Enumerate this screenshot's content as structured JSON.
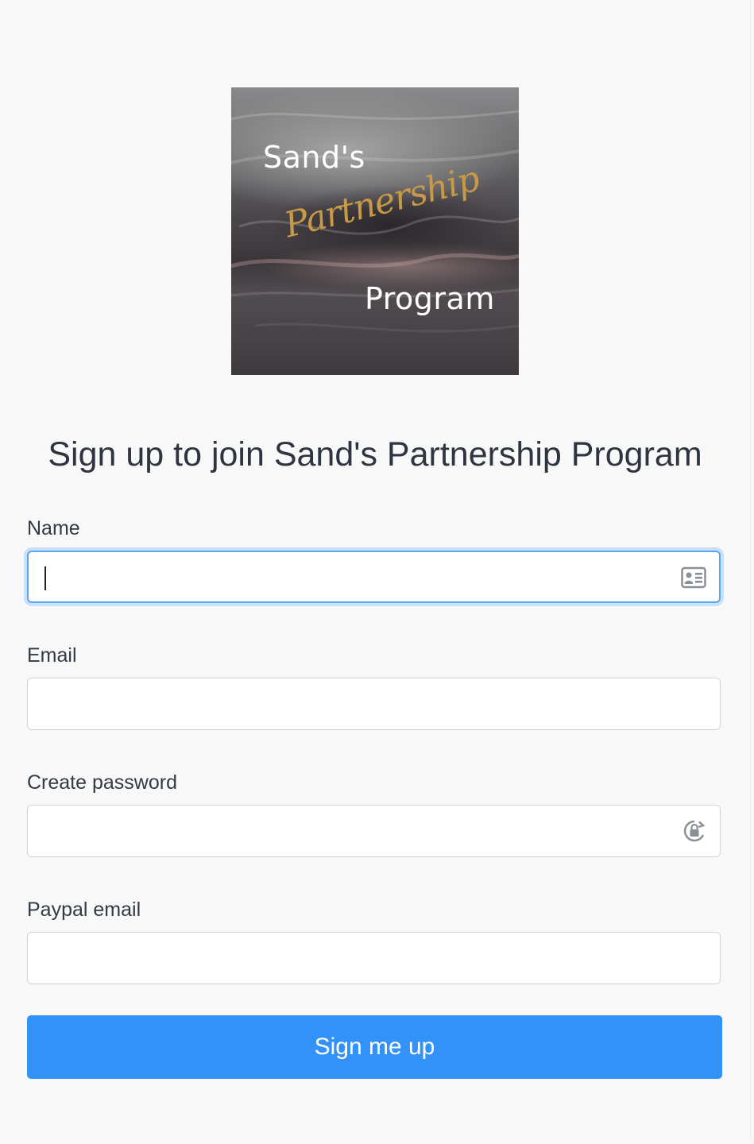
{
  "logo": {
    "line1": "Sand's",
    "line2": "Partnership",
    "line3": "Program"
  },
  "heading": "Sign up to join Sand's Partnership Program",
  "form": {
    "name": {
      "label": "Name",
      "value": "",
      "icon": "contact-card-icon",
      "focused": true
    },
    "email": {
      "label": "Email",
      "value": ""
    },
    "password": {
      "label": "Create password",
      "value": "",
      "icon": "password-key-icon"
    },
    "paypal_email": {
      "label": "Paypal email",
      "value": ""
    },
    "submit_label": "Sign me up"
  },
  "colors": {
    "primary": "#3392f8",
    "focus_ring": "#5aa7f4",
    "gold_script": "#c99a46"
  }
}
